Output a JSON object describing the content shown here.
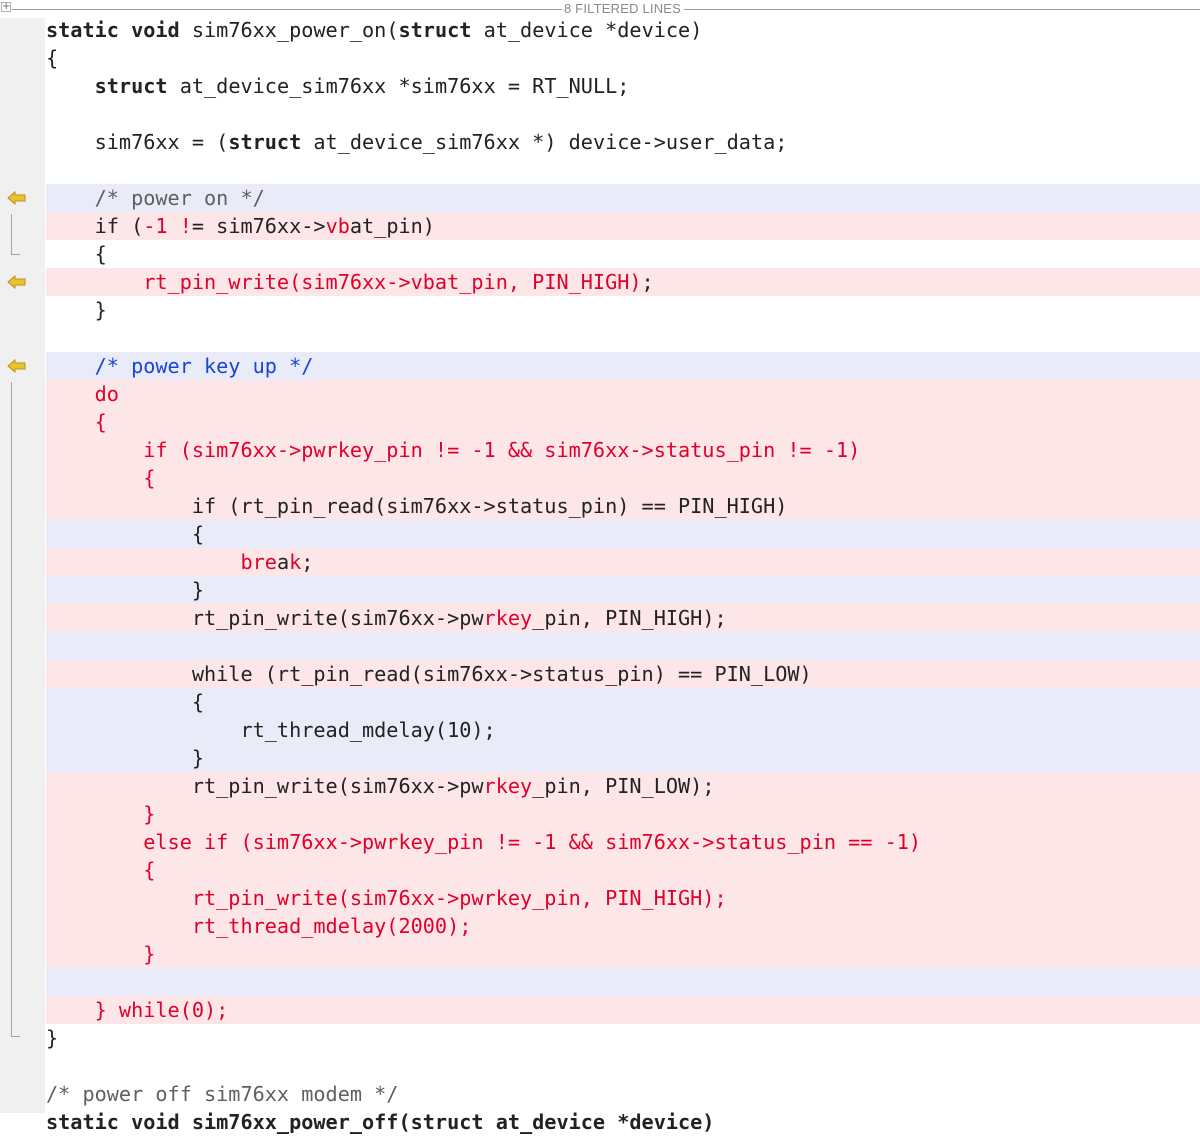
{
  "filter_bar": {
    "label": "8 FILTERED LINES",
    "expand_glyph": "+"
  },
  "colors": {
    "changed_line_bg": "#e9ebf8",
    "added_line_bg": "#fde6e8",
    "added_text": "#e1002a",
    "comment_blue": "#1a44d8",
    "gutter_bg": "#f0f0f0",
    "marker": "#e9c42f"
  },
  "gutter": {
    "markers": [
      {
        "icon": "arrow-left-icon",
        "line": 7
      },
      {
        "icon": "arrow-left-icon",
        "line": 10
      },
      {
        "icon": "arrow-left-icon",
        "line": 13
      }
    ]
  },
  "code_lines": [
    {
      "bg": "none",
      "spans": [
        {
          "t": "static void",
          "c": "kw"
        },
        {
          "t": " sim76xx_power_on("
        },
        {
          "t": "struct",
          "c": "kw"
        },
        {
          "t": " at_device *device)"
        }
      ]
    },
    {
      "bg": "none",
      "spans": [
        {
          "t": "{"
        }
      ]
    },
    {
      "bg": "none",
      "spans": [
        {
          "t": "    "
        },
        {
          "t": "struct",
          "c": "kw"
        },
        {
          "t": " at_device_sim76xx *sim76xx = RT_NULL;"
        }
      ]
    },
    {
      "bg": "none",
      "spans": [
        {
          "t": ""
        }
      ]
    },
    {
      "bg": "none",
      "spans": [
        {
          "t": "    sim76xx = ("
        },
        {
          "t": "struct",
          "c": "kw"
        },
        {
          "t": " at_device_sim76xx *) device->user_data;"
        }
      ]
    },
    {
      "bg": "none",
      "spans": [
        {
          "t": ""
        }
      ]
    },
    {
      "bg": "blue",
      "spans": [
        {
          "t": "    /* power on */",
          "c": "cmt-gray"
        }
      ]
    },
    {
      "bg": "red",
      "spans": [
        {
          "t": "    if ("
        },
        {
          "t": "-1",
          "c": "add"
        },
        {
          "t": " "
        },
        {
          "t": "!",
          "c": "add"
        },
        {
          "t": "= sim76xx->"
        },
        {
          "t": "vb",
          "c": "add"
        },
        {
          "t": "at_pin)"
        }
      ]
    },
    {
      "bg": "none",
      "spans": [
        {
          "t": "    {"
        }
      ]
    },
    {
      "bg": "red",
      "spans": [
        {
          "t": "        "
        },
        {
          "t": "rt_pin_write(sim76xx->vbat_pin, PIN_HIGH)",
          "c": "add"
        },
        {
          "t": ";"
        }
      ]
    },
    {
      "bg": "none",
      "spans": [
        {
          "t": "    }"
        }
      ]
    },
    {
      "bg": "none",
      "spans": [
        {
          "t": ""
        }
      ]
    },
    {
      "bg": "blue",
      "spans": [
        {
          "t": "    /* power key up */",
          "c": "cmt-blue"
        }
      ]
    },
    {
      "bg": "red",
      "spans": [
        {
          "t": "    do",
          "c": "add"
        }
      ]
    },
    {
      "bg": "red",
      "spans": [
        {
          "t": "    {",
          "c": "add"
        }
      ]
    },
    {
      "bg": "red",
      "spans": [
        {
          "t": "        if (sim76xx->pwrkey_pin != -1 && sim76xx->status_pin != -1)",
          "c": "add"
        }
      ]
    },
    {
      "bg": "red",
      "spans": [
        {
          "t": "        {",
          "c": "add"
        }
      ]
    },
    {
      "bg": "red",
      "spans": [
        {
          "t": "            if (rt_pin_read(sim76xx->status_pin) == PIN_HIGH)"
        }
      ]
    },
    {
      "bg": "blue",
      "spans": [
        {
          "t": "            {"
        }
      ]
    },
    {
      "bg": "red",
      "spans": [
        {
          "t": "                "
        },
        {
          "t": "bre",
          "c": "add"
        },
        {
          "t": "a"
        },
        {
          "t": "k",
          "c": "add"
        },
        {
          "t": ";"
        }
      ]
    },
    {
      "bg": "blue",
      "spans": [
        {
          "t": "            }"
        }
      ]
    },
    {
      "bg": "red",
      "spans": [
        {
          "t": "            rt_pin_write(sim76xx->pw"
        },
        {
          "t": "rkey",
          "c": "add"
        },
        {
          "t": "_pin, PIN_HIGH);"
        }
      ]
    },
    {
      "bg": "blue",
      "spans": [
        {
          "t": ""
        }
      ]
    },
    {
      "bg": "red",
      "spans": [
        {
          "t": "            while (rt_pin_read(sim76xx->status_pin) == PIN_LOW)"
        }
      ]
    },
    {
      "bg": "blue",
      "spans": [
        {
          "t": "            {"
        }
      ]
    },
    {
      "bg": "blue",
      "spans": [
        {
          "t": "                rt_thread_mdelay(10);"
        }
      ]
    },
    {
      "bg": "blue",
      "spans": [
        {
          "t": "            }"
        }
      ]
    },
    {
      "bg": "red",
      "spans": [
        {
          "t": "            rt_pin_write(sim76xx->pw"
        },
        {
          "t": "rkey",
          "c": "add"
        },
        {
          "t": "_pin, PIN_LOW);"
        }
      ]
    },
    {
      "bg": "red",
      "spans": [
        {
          "t": "        }",
          "c": "add"
        }
      ]
    },
    {
      "bg": "red",
      "spans": [
        {
          "t": "        else if (sim76xx->pwrkey_pin != -1 && sim76xx->status_pin == -1)",
          "c": "add"
        }
      ]
    },
    {
      "bg": "red",
      "spans": [
        {
          "t": "        {",
          "c": "add"
        }
      ]
    },
    {
      "bg": "red",
      "spans": [
        {
          "t": "            rt_pin_write(sim76xx->pwrkey_pin, PIN_HIGH);",
          "c": "add"
        }
      ]
    },
    {
      "bg": "red",
      "spans": [
        {
          "t": "            rt_thread_mdelay(2000);",
          "c": "add"
        }
      ]
    },
    {
      "bg": "red",
      "spans": [
        {
          "t": "        }",
          "c": "add"
        }
      ]
    },
    {
      "bg": "blue",
      "spans": [
        {
          "t": ""
        }
      ]
    },
    {
      "bg": "red",
      "spans": [
        {
          "t": "    } while(0);",
          "c": "add"
        }
      ]
    },
    {
      "bg": "none",
      "spans": [
        {
          "t": "}"
        }
      ]
    },
    {
      "bg": "none",
      "spans": [
        {
          "t": ""
        }
      ]
    },
    {
      "bg": "none",
      "spans": [
        {
          "t": "/* power off sim76xx modem */",
          "c": "cmt-gray"
        }
      ]
    },
    {
      "bg": "none",
      "spans": [
        {
          "t": "static void sim76xx_power_off(struct at_device *device)",
          "c": "kw"
        }
      ]
    }
  ]
}
